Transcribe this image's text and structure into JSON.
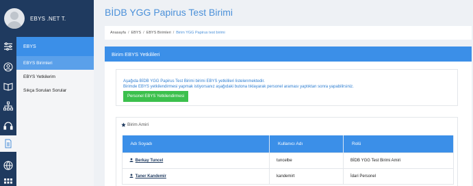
{
  "profile": {
    "name": "EBYS .NET T."
  },
  "sidebar": {
    "icons": [
      "sliders-icon",
      "user-circle-icon",
      "book-icon",
      "sitemap-icon",
      "headset-icon",
      "document-icon",
      "globe-icon",
      "grid-icon"
    ],
    "menu_head": "EBYS",
    "items": [
      {
        "label": "EBYS Birimleri",
        "selected": true
      },
      {
        "label": "EBYS Yetkilerim",
        "selected": false
      },
      {
        "label": "Sıkça Sorulan Sorular",
        "selected": false
      }
    ]
  },
  "header": {
    "title": "BİDB YGG Papirus Test Birimi"
  },
  "breadcrumb": [
    "Anasayfa",
    "EBYS",
    "EBYS Birimleri",
    "Birim YGG Papirus test birimi"
  ],
  "panel": {
    "title": "Birim EBYS Yetkilileri",
    "info_line1": "Aşağıda BİDB YGG Papirus Test Birimi birimi EBYS yetkilileri listelenmektedir.",
    "info_line2": "Birimde EBYS yetkilendirmesi yapmak istiyorsanız aşağıdaki butona tıklayarak personel araması yaptıktan sonra yapabilirsiniz.",
    "button_label": "Personel EBYS Yetkilendirmesi"
  },
  "section": {
    "title": "Birim Amiri",
    "columns": [
      "Adı Soyadı",
      "Kullanıcı Adı",
      "Rolü"
    ],
    "rows": [
      {
        "name": "Berkay Tuncel",
        "username": "tuncelbe",
        "role": "BİDB YGG Test Birimi Amiri"
      },
      {
        "name": "Taner Kandemir",
        "username": "kandemirt",
        "role": "İdari Personel"
      }
    ]
  },
  "colors": {
    "sidebar_dark": "#1f3a5f",
    "accent_blue": "#3b8fe8",
    "button_green": "#3cc04d"
  }
}
